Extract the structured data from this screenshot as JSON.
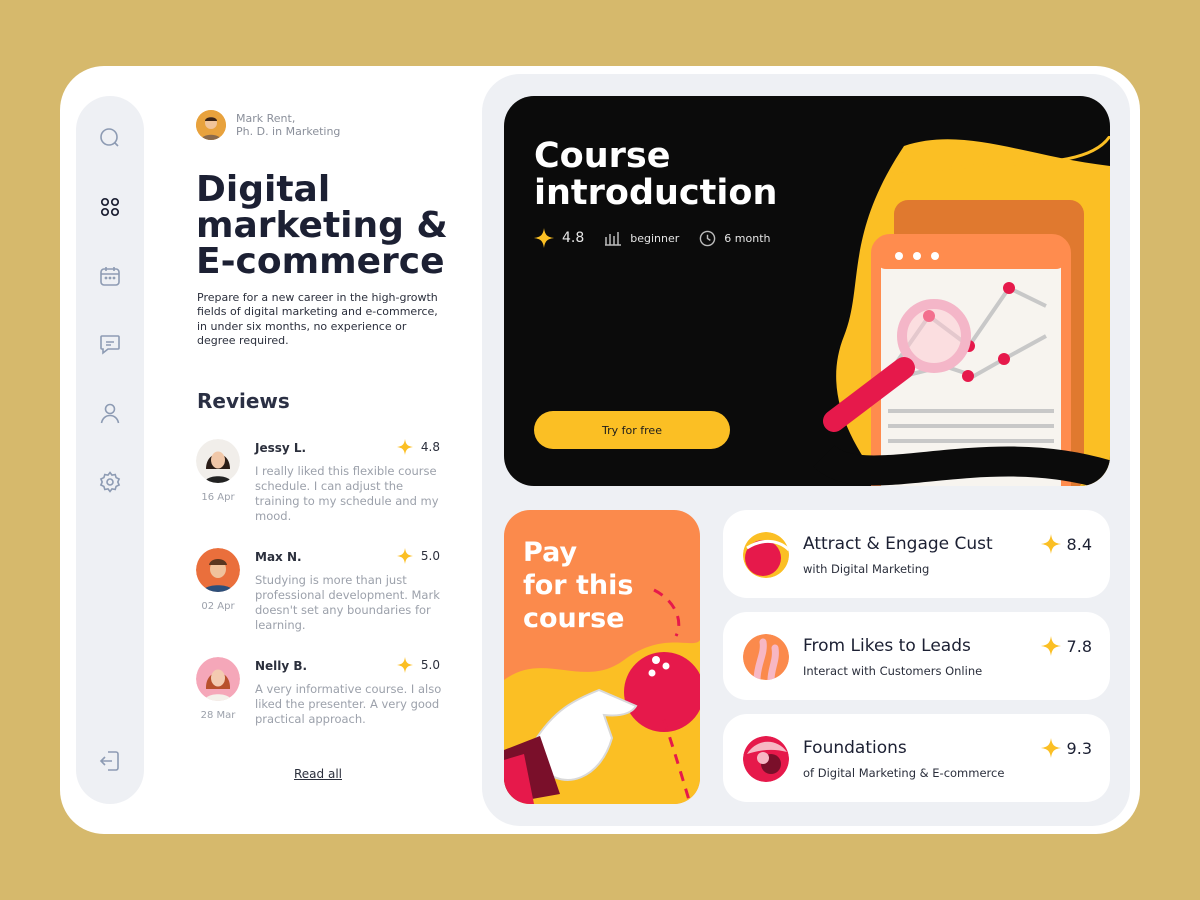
{
  "author": {
    "name": "Mark Rent,",
    "role": "Ph. D. in Marketing"
  },
  "course": {
    "title_lines": [
      "Digital",
      "marketing &",
      "E-commerce"
    ],
    "description": "Prepare for a new career in the high-growth fields of digital marketing and e-commerce, in under six months, no experience or degree required."
  },
  "reviews": {
    "heading": "Reviews",
    "items": [
      {
        "name": "Jessy L.",
        "rating": "4.8",
        "date": "16 Apr",
        "text": "I really liked this flexible course schedule. I can adjust the training to my schedule and my mood."
      },
      {
        "name": "Max N.",
        "rating": "5.0",
        "date": "02 Apr",
        "text": "Studying is more than just professional development. Mark doesn't set any boundaries for learning."
      },
      {
        "name": "Nelly B.",
        "rating": "5.0",
        "date": "28 Mar",
        "text": "A very informative course. I also liked the presenter. A very good practical approach."
      }
    ],
    "read_all": "Read all"
  },
  "hero": {
    "title_line1": "Course",
    "title_line2": "introduction",
    "rating": "4.8",
    "level": "beginner",
    "duration": "6 month",
    "cta": "Try for free"
  },
  "pay_card": {
    "line1": "Pay",
    "line2": "for this",
    "line3": "course"
  },
  "courses": [
    {
      "title": "Attract & Engage Cust",
      "subtitle": "with Digital Marketing",
      "rating": "8.4"
    },
    {
      "title": "From Likes to Leads",
      "subtitle": "Interact with Customers Online",
      "rating": "7.8"
    },
    {
      "title": "Foundations",
      "subtitle": "of Digital Marketing & E-commerce",
      "rating": "9.3"
    }
  ],
  "colors": {
    "accent": "#fbbf24",
    "dark": "#0b0b0b",
    "orange": "#fb8a4c",
    "pink": "#e6194b",
    "background": "#d6b96c"
  },
  "sidebar_icons": [
    "search-icon",
    "apps-icon",
    "calendar-icon",
    "chat-icon",
    "user-icon",
    "settings-icon",
    "logout-icon"
  ]
}
